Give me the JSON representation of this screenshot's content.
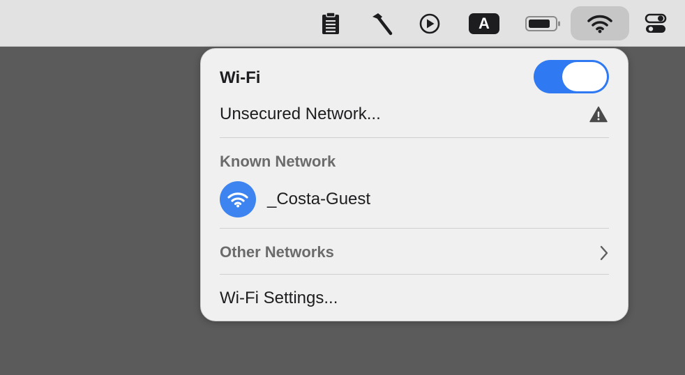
{
  "menubar": {
    "icons": [
      "clipboard-icon",
      "hammer-icon",
      "play-icon",
      "input-source-icon",
      "battery-icon",
      "wifi-icon",
      "control-center-icon"
    ],
    "input_source_label": "A"
  },
  "wifi_menu": {
    "title": "Wi-Fi",
    "toggle_on": true,
    "unsecured_network_label": "Unsecured Network...",
    "known_network_header": "Known Network",
    "known_networks": [
      {
        "name": "_Costa-Guest"
      }
    ],
    "other_networks_label": "Other Networks",
    "settings_label": "Wi-Fi Settings..."
  },
  "colors": {
    "accent": "#2f79f3",
    "network_icon_bg": "#3d84f1",
    "panel_bg": "#f0f0f0",
    "menubar_bg": "#e2e2e2",
    "desktop_bg": "#5b5b5b"
  }
}
